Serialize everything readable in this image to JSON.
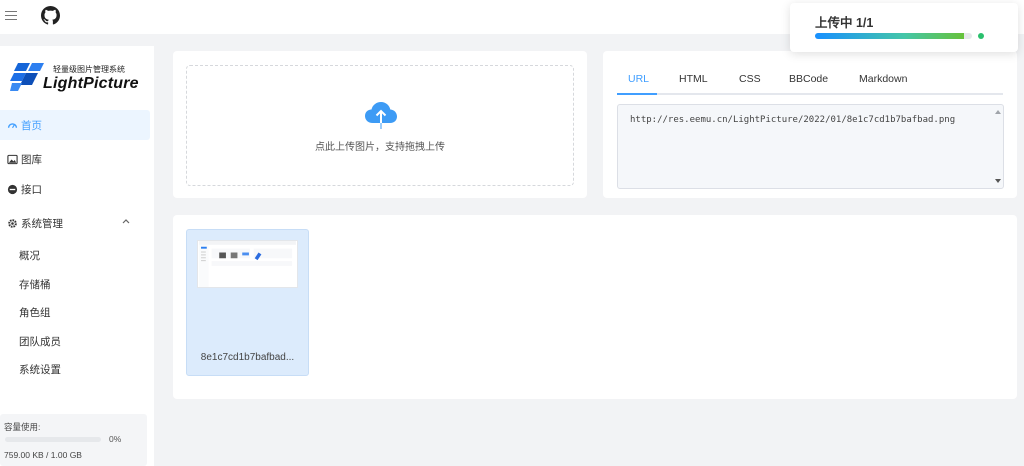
{
  "topbar": {
    "menu_icon": "menu-icon",
    "github_icon": "github-icon"
  },
  "brand": {
    "subtitle": "轻量级图片管理系统",
    "name": "LightPicture"
  },
  "nav": {
    "home": "首页",
    "gallery": "图库",
    "api": "接口",
    "system": "系统管理",
    "submenu": [
      "概况",
      "存储桶",
      "角色组",
      "团队成员",
      "系统设置"
    ]
  },
  "usage": {
    "label": "容量使用:",
    "percent": "0%",
    "detail": "759.00 KB / 1.00 GB",
    "fill": 0.0
  },
  "upload": {
    "text": "点此上传图片，支持拖拽上传",
    "icon": "cloud-upload-icon"
  },
  "links": {
    "tabs": [
      "URL",
      "HTML",
      "CSS",
      "BBCode",
      "Markdown"
    ],
    "active_tab": "URL",
    "value": "http://res.eemu.cn/LightPicture/2022/01/8e1c7cd1b7bafbad.png"
  },
  "gallery": {
    "items": [
      {
        "name": "8e1c7cd1b7bafbad..."
      }
    ]
  },
  "notification": {
    "title": "上传中 1/1",
    "progress": 0.95
  },
  "colors": {
    "accent": "#409eff",
    "success": "#2ac06d",
    "background": "#f2f3f5"
  }
}
